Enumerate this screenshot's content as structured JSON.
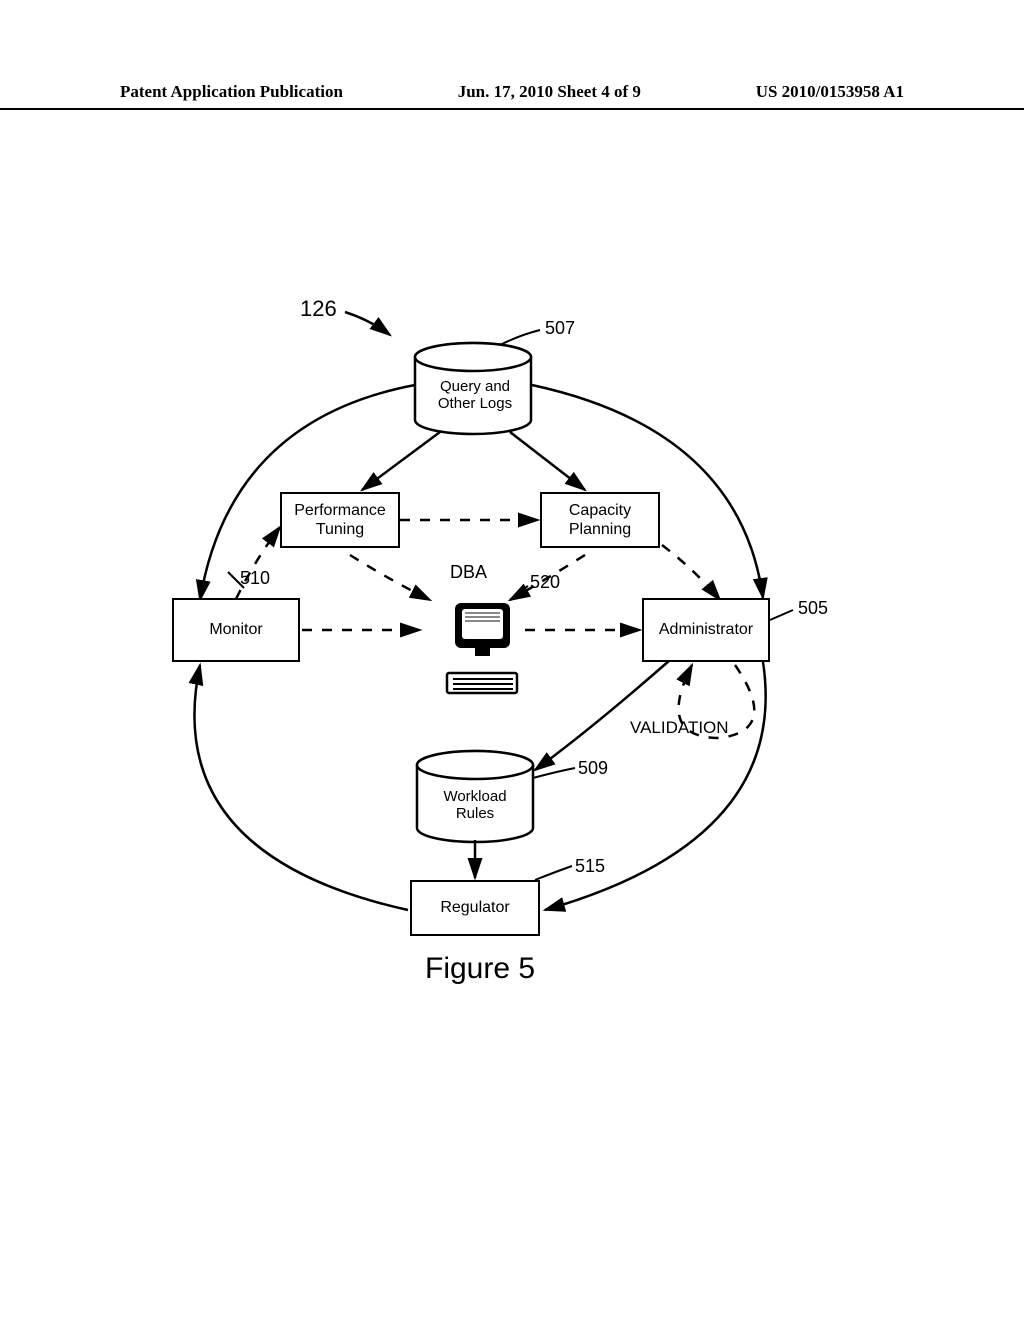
{
  "header": {
    "left": "Patent Application Publication",
    "center": "Jun. 17, 2010  Sheet 4 of 9",
    "right": "US 2010/0153958 A1"
  },
  "figure": {
    "top_ref": "126",
    "caption": "Figure 5",
    "dba_label": "DBA",
    "validation_label": "VALIDATION",
    "components": {
      "logs": {
        "label": "Query and Other Logs",
        "ref": "507"
      },
      "tuning": {
        "label": "Performance Tuning"
      },
      "planning": {
        "label": "Capacity Planning"
      },
      "monitor": {
        "label": "Monitor",
        "ref": "510"
      },
      "admin": {
        "label": "Administrator",
        "ref": "505"
      },
      "dba_center": {
        "ref": "520"
      },
      "rules": {
        "label": "Workload Rules",
        "ref": "509"
      },
      "regulator": {
        "label": "Regulator",
        "ref": "515"
      }
    }
  }
}
